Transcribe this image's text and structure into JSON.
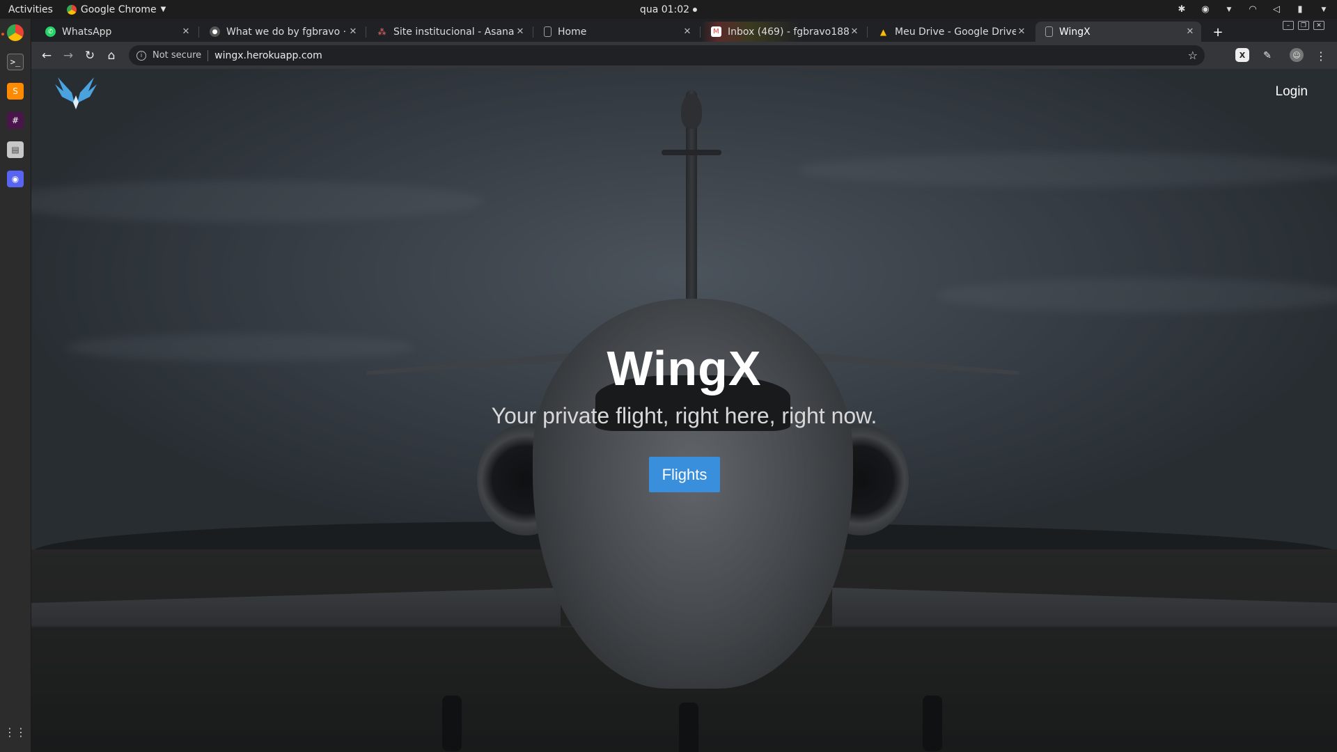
{
  "system": {
    "activities_label": "Activities",
    "app_name": "Google Chrome",
    "clock": "qua 01:02"
  },
  "browser": {
    "tabs": [
      {
        "label": "WhatsApp",
        "icon": "whatsapp-icon",
        "color": "#25d366"
      },
      {
        "label": "What we do by fgbravo · F",
        "icon": "github-icon",
        "color": "#6e6e6e"
      },
      {
        "label": "Site institucional - Asana",
        "icon": "asana-icon",
        "color": "#f06a6a"
      },
      {
        "label": "Home",
        "icon": "page-icon",
        "color": "#9aa0a6"
      },
      {
        "label": "Inbox (469) - fgbravo188@",
        "icon": "gmail-icon",
        "color": "#ea4335"
      },
      {
        "label": "Meu Drive - Google Drive",
        "icon": "drive-icon",
        "color": "#fbbc04"
      },
      {
        "label": "WingX",
        "icon": "page-icon",
        "color": "#9aa0a6"
      }
    ],
    "security_label": "Not secure",
    "url": "wingx.herokuapp.com"
  },
  "site": {
    "login_label": "Login",
    "title": "WingX",
    "subtitle": "Your private flight, right here, right now.",
    "cta_label": "Flights",
    "accent_color": "#3a8fdc",
    "logo_color": "#4aa3df"
  }
}
